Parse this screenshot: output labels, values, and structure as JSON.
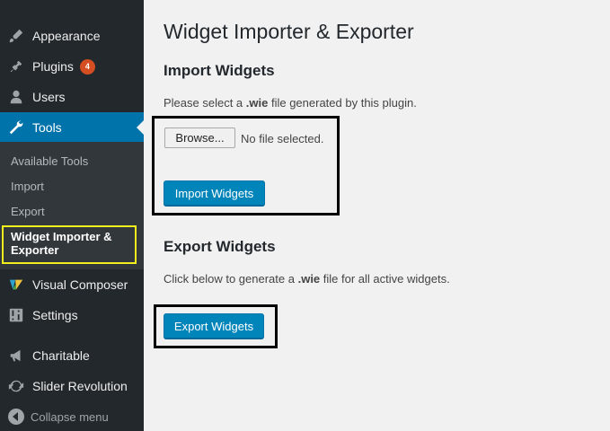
{
  "sidebar": {
    "items": [
      {
        "label": "Appearance",
        "icon": "paintbrush-icon"
      },
      {
        "label": "Plugins",
        "icon": "plugin-icon",
        "badge": "4"
      },
      {
        "label": "Users",
        "icon": "users-icon"
      },
      {
        "label": "Tools",
        "icon": "wrench-icon",
        "current": true
      },
      {
        "label": "Visual Composer",
        "icon": "visual-composer-icon"
      },
      {
        "label": "Settings",
        "icon": "settings-icon"
      },
      {
        "label": "Charitable",
        "icon": "megaphone-icon"
      },
      {
        "label": "Slider Revolution",
        "icon": "refresh-icon"
      }
    ],
    "submenu": [
      "Available Tools",
      "Import",
      "Export",
      "Widget Importer & Exporter"
    ],
    "collapse_label": "Collapse menu"
  },
  "main": {
    "title": "Widget Importer & Exporter",
    "import": {
      "heading": "Import Widgets",
      "desc_before": "Please select a ",
      "desc_bold": ".wie",
      "desc_after": " file generated by this plugin.",
      "browse_label": "Browse...",
      "file_status": "No file selected.",
      "button_label": "Import Widgets"
    },
    "export": {
      "heading": "Export Widgets",
      "desc_before": "Click below to generate a ",
      "desc_bold": ".wie",
      "desc_after": " file for all active widgets.",
      "button_label": "Export Widgets"
    }
  },
  "colors": {
    "sidebar_bg": "#23282d",
    "submenu_bg": "#32373c",
    "current_bg": "#0073aa",
    "button_primary": "#0085ba",
    "badge": "#d54e21",
    "highlight_yellow": "#f2ee1d"
  }
}
